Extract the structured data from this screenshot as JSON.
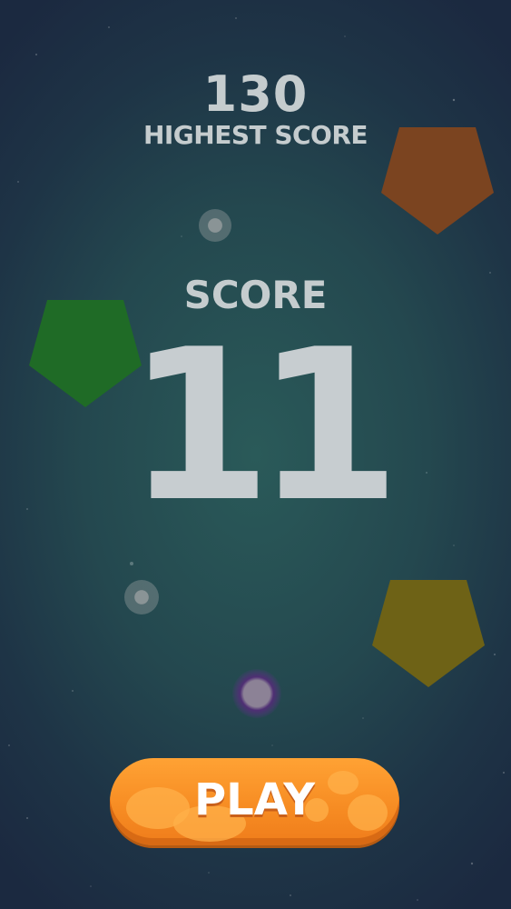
{
  "highest_score": {
    "value": "130",
    "label": "HIGHEST SCORE"
  },
  "current_score": {
    "label": "SCORE",
    "value": "11"
  },
  "play_button": {
    "label": "PLAY"
  },
  "colors": {
    "background": "#24484f",
    "text": "#c5ccce",
    "pentagon_orange": "#7b4420",
    "pentagon_green": "#1f6b26",
    "pentagon_olive": "#6e6216",
    "button": "#f68b22"
  },
  "objects": [
    {
      "type": "pentagon",
      "color": "orange"
    },
    {
      "type": "pentagon",
      "color": "green"
    },
    {
      "type": "pentagon",
      "color": "olive"
    },
    {
      "type": "orb",
      "color": "grey"
    },
    {
      "type": "orb",
      "color": "grey"
    },
    {
      "type": "orb",
      "color": "purple-glow"
    }
  ]
}
